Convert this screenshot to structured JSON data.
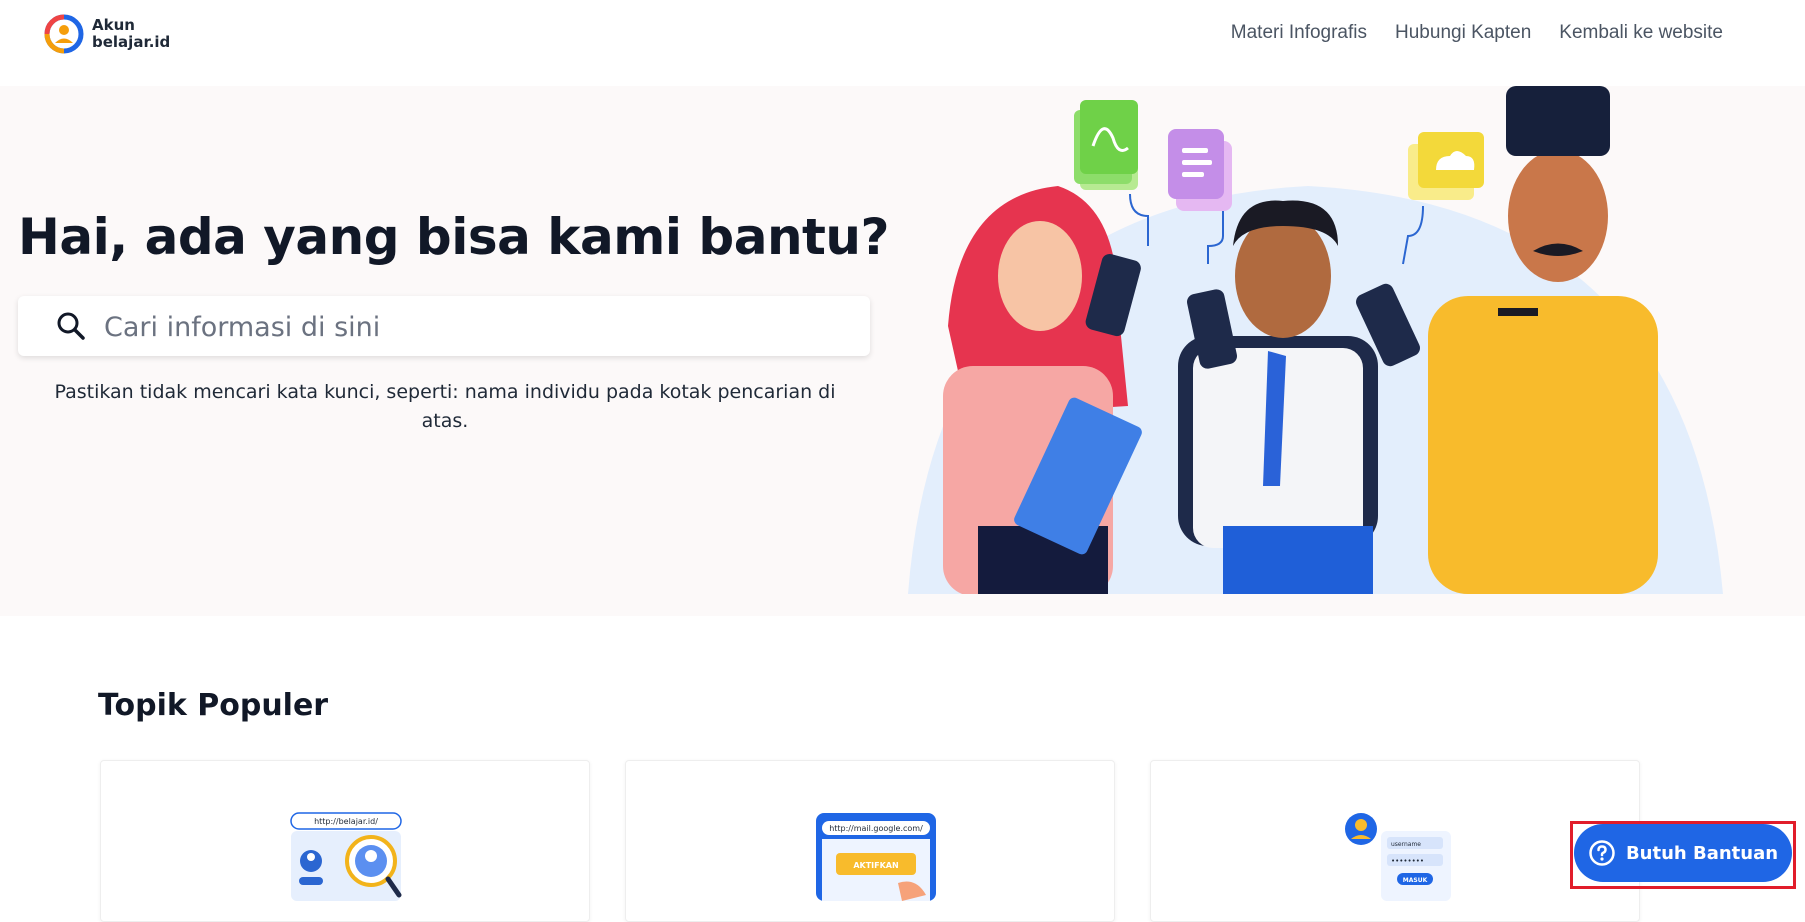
{
  "brand": {
    "line1": "Akun",
    "line2": "belajar.id"
  },
  "nav": [
    {
      "label": "Materi Infografis"
    },
    {
      "label": "Hubungi Kapten"
    },
    {
      "label": "Kembali ke website"
    }
  ],
  "hero": {
    "title": "Hai, ada yang bisa kami bantu?",
    "search_placeholder": "Cari informasi di sini",
    "search_value": "",
    "hint": "Pastikan tidak mencari kata kunci, seperti: nama individu pada kotak pencarian di atas."
  },
  "topics": {
    "title": "Topik Populer",
    "cards": [
      {
        "illustration": "search-account-illustration",
        "url_text": "http://belajar.id/"
      },
      {
        "illustration": "activation-email-illustration",
        "url_text": "http://mail.google.com/",
        "button_text": "AKTIFKAN"
      },
      {
        "illustration": "login-form-illustration",
        "field1": "username",
        "button_text": "MASUK"
      }
    ]
  },
  "help": {
    "label": "Butuh Bantuan",
    "icon": "question-circle-icon"
  },
  "colors": {
    "primary": "#1f66e5",
    "highlight": "#e11d2a",
    "hero_bg": "#fcf9f9",
    "text": "#111827"
  }
}
